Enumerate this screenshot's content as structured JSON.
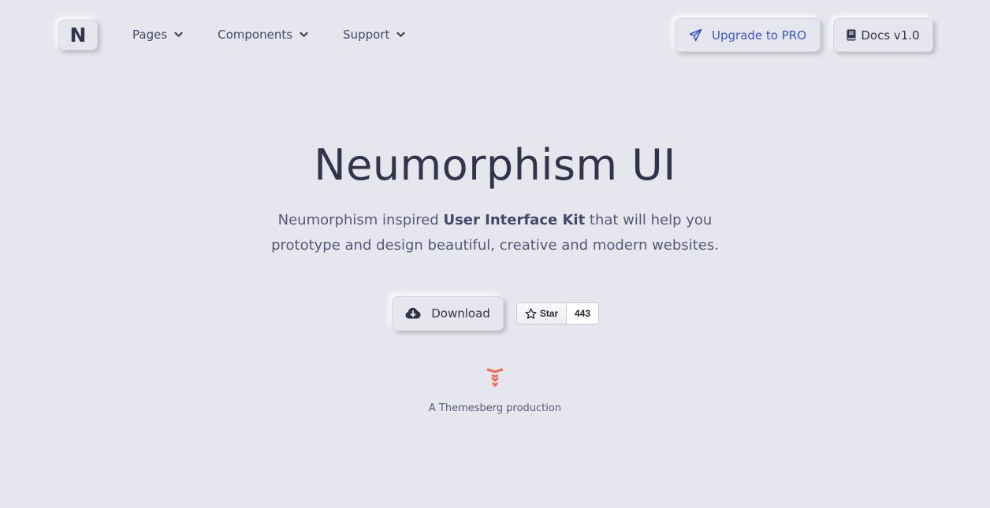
{
  "nav": {
    "logo_letter": "N",
    "items": [
      {
        "label": "Pages"
      },
      {
        "label": "Components"
      },
      {
        "label": "Support"
      }
    ],
    "upgrade_label": "Upgrade to PRO",
    "docs_label": "Docs v1.0"
  },
  "hero": {
    "title": "Neumorphism UI",
    "subtitle_pre": "Neumorphism inspired ",
    "subtitle_strong": "User Interface Kit",
    "subtitle_post": " that will help you prototype and design beautiful, creative and modern websites.",
    "download_label": "Download",
    "star_label": "Star",
    "star_count": "443"
  },
  "footer": {
    "credit": "A Themesberg production"
  },
  "icons": {
    "chevron": "chevron-down-icon",
    "upgrade": "paper-plane-icon",
    "docs": "book-icon",
    "download": "cloud-download-icon",
    "star": "star-outline-icon",
    "brand": "themesberg-logo"
  },
  "colors": {
    "background": "#e6e7ee",
    "text": "#44476a",
    "heading": "#31344b",
    "accent": "#3a55c8",
    "brand": "#e8725c"
  }
}
